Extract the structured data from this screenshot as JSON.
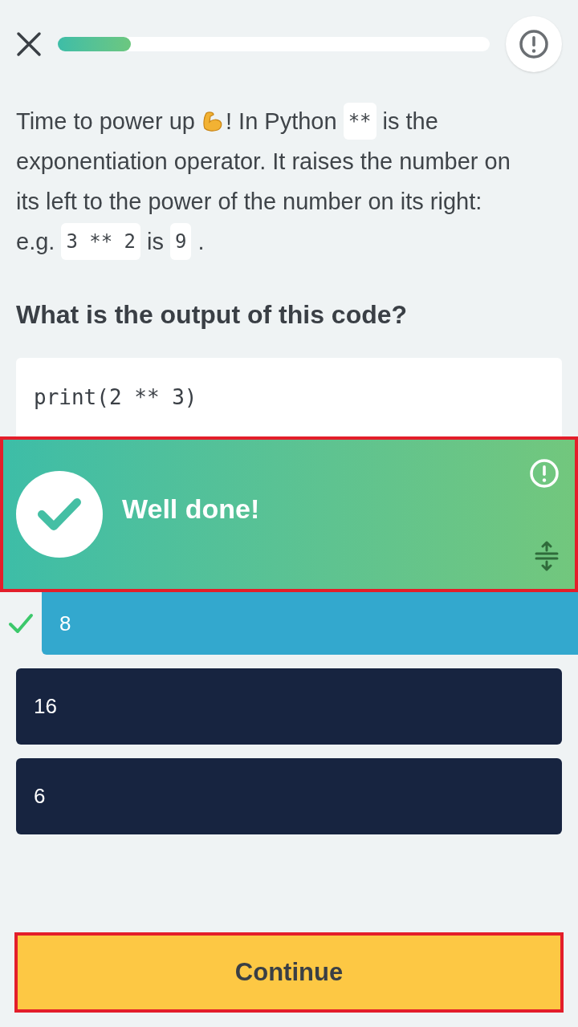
{
  "progress": {
    "level": 0.17
  },
  "explanation_lines": [
    [
      {
        "kind": "text",
        "text": "Time to power up"
      },
      {
        "kind": "emoji"
      },
      {
        "kind": "text",
        "text": "! In Python"
      },
      {
        "kind": "code",
        "text": "**"
      },
      {
        "kind": "text",
        "text": "is the"
      }
    ],
    [
      {
        "kind": "text",
        "text": "exponentiation operator. It raises the number on"
      }
    ],
    [
      {
        "kind": "text",
        "text": "its left to the power of the number on its right:"
      }
    ],
    [
      {
        "kind": "text",
        "text": "e.g."
      },
      {
        "kind": "code",
        "text": "3 ** 2"
      },
      {
        "kind": "text",
        "text": "is"
      },
      {
        "kind": "code",
        "text": "9"
      },
      {
        "kind": "text",
        "text": "."
      }
    ]
  ],
  "question": "What is the output of this code?",
  "code": "print(2 ** 3)",
  "feedback": {
    "message": "Well done!",
    "correct": true
  },
  "options": [
    {
      "label": "8",
      "selected": true
    },
    {
      "label": "16",
      "selected": false
    },
    {
      "label": "6",
      "selected": false
    }
  ],
  "continue_button": "Continue"
}
